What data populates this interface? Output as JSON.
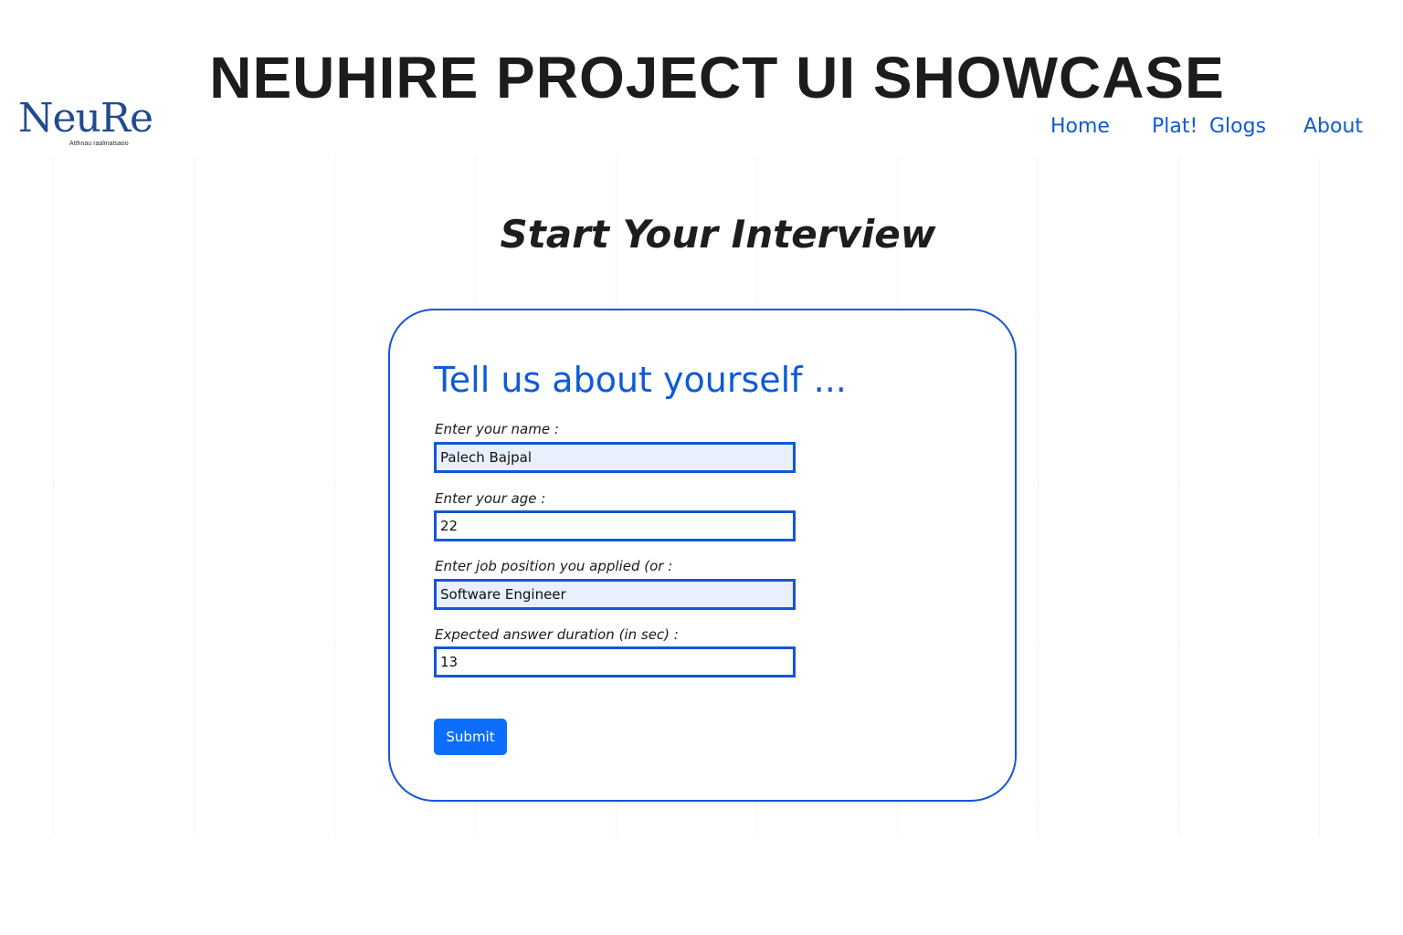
{
  "header": {
    "title": "NEUHIRE PROJECT UI SHOWCASE",
    "logo": {
      "text": "NeuRe",
      "tagline": "Atthnau raalmatsaoo"
    },
    "nav": [
      {
        "label": "Home"
      },
      {
        "label": "Plat!"
      },
      {
        "label": "Glogs"
      },
      {
        "label": "About"
      }
    ]
  },
  "main": {
    "heading": "Start Your Interview",
    "form": {
      "title": "Tell us about yourself ...",
      "fields": [
        {
          "label": "Enter your name :",
          "value": "Palech Bajpal"
        },
        {
          "label": "Enter your age :",
          "value": "22"
        },
        {
          "label": "Enter job position you applied (or :",
          "value": "Software Engineer"
        },
        {
          "label": "Expected answer duration (in sec) :",
          "value": "13"
        }
      ],
      "submit_label": "Submit"
    }
  },
  "colors": {
    "accent": "#0d5bd6",
    "border": "#1555d8",
    "button": "#0d6efd",
    "autofill_bg": "#e8f0fe"
  }
}
